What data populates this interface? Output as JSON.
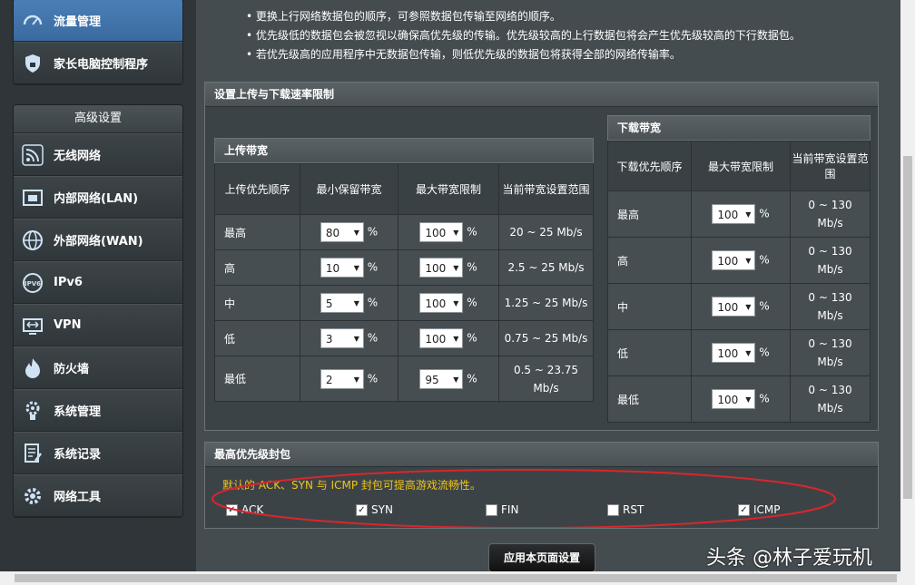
{
  "sidebar": {
    "top_items": [
      {
        "label": "流量管理",
        "icon": "speedometer-icon",
        "active": true
      },
      {
        "label": "家长电脑控制程序",
        "icon": "lock-icon",
        "active": false
      }
    ],
    "advanced_header": "高级设置",
    "items": [
      {
        "label": "无线网络",
        "icon": "wifi-icon"
      },
      {
        "label": "内部网络(LAN)",
        "icon": "lan-icon"
      },
      {
        "label": "外部网络(WAN)",
        "icon": "globe-icon"
      },
      {
        "label": "IPv6",
        "icon": "ipv6-icon"
      },
      {
        "label": "VPN",
        "icon": "vpn-icon"
      },
      {
        "label": "防火墙",
        "icon": "firewall-icon"
      },
      {
        "label": "系统管理",
        "icon": "admin-icon"
      },
      {
        "label": "系统记录",
        "icon": "log-icon"
      },
      {
        "label": "网络工具",
        "icon": "tools-icon"
      }
    ]
  },
  "bullets": [
    "更换上行网络数据包的顺序，可参照数据包传输至网络的顺序。",
    "优先级低的数据包会被忽视以确保高优先级的传输。优先级较高的上行数据包将会产生优先级较高的下行数据包。",
    "若优先级高的应用程序中无数据包传输，则低优先级的数据包将获得全部的网络传输率。"
  ],
  "rate_panel": {
    "title": "设置上传与下载速率限制"
  },
  "upload": {
    "title": "上传带宽",
    "headers": [
      "上传优先顺序",
      "最小保留带宽",
      "最大带宽限制",
      "当前带宽设置范围"
    ],
    "rows": [
      {
        "priority": "最高",
        "min": "80",
        "max": "100",
        "range": "20 ~ 25 Mb/s"
      },
      {
        "priority": "高",
        "min": "10",
        "max": "100",
        "range": "2.5 ~ 25 Mb/s"
      },
      {
        "priority": "中",
        "min": "5",
        "max": "100",
        "range": "1.25 ~ 25 Mb/s"
      },
      {
        "priority": "低",
        "min": "3",
        "max": "100",
        "range": "0.75 ~ 25 Mb/s"
      },
      {
        "priority": "最低",
        "min": "2",
        "max": "95",
        "range": "0.5 ~ 23.75 Mb/s"
      }
    ],
    "unit": "%"
  },
  "download": {
    "title": "下载带宽",
    "headers": [
      "下载优先顺序",
      "最大带宽限制",
      "当前带宽设置范围"
    ],
    "rows": [
      {
        "priority": "最高",
        "max": "100",
        "range": "0 ~ 130 Mb/s"
      },
      {
        "priority": "高",
        "max": "100",
        "range": "0 ~ 130 Mb/s"
      },
      {
        "priority": "中",
        "max": "100",
        "range": "0 ~ 130 Mb/s"
      },
      {
        "priority": "低",
        "max": "100",
        "range": "0 ~ 130 Mb/s"
      },
      {
        "priority": "最低",
        "max": "100",
        "range": "0 ~ 130 Mb/s"
      }
    ],
    "unit": "%"
  },
  "priority_panel": {
    "title": "最高优先级封包",
    "note": "默认的 ACK、SYN 与 ICMP 封包可提高游戏流畅性。",
    "checkboxes": [
      {
        "label": "ACK",
        "checked": true
      },
      {
        "label": "SYN",
        "checked": true
      },
      {
        "label": "FIN",
        "checked": false
      },
      {
        "label": "RST",
        "checked": false
      },
      {
        "label": "ICMP",
        "checked": true
      }
    ]
  },
  "apply_button": "应用本页面设置",
  "watermark": "头条 @林子爱玩机",
  "colors": {
    "note": "#f0c419",
    "highlight_ellipse": "#d9262c",
    "active_nav": "#3a6aa0"
  }
}
